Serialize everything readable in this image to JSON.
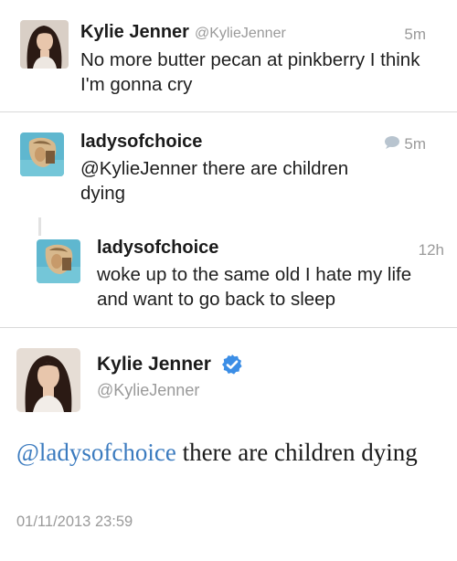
{
  "tweets": [
    {
      "name": "Kylie Jenner",
      "handle": "@KylieJenner",
      "time": "5m",
      "text": "No more butter pecan at pinkberry I think I'm gonna cry"
    },
    {
      "name": "ladysofchoice",
      "time": "5m",
      "text": "@KylieJenner there are children dying"
    },
    {
      "name": "ladysofchoice",
      "time": "12h",
      "text": "woke up to the same old I hate my life and want to go back to sleep"
    }
  ],
  "featured": {
    "name": "Kylie Jenner",
    "handle": "@KylieJenner",
    "mention": "@ladysofchoice",
    "text": " there are children dying",
    "timestamp": "01/11/2013 23:59"
  },
  "icons": {
    "reply": "speech-bubble-icon",
    "verified": "verified-badge-icon"
  },
  "colors": {
    "link": "#3b7bbf",
    "verified": "#3c8ee6",
    "muted": "#9a9a9a"
  }
}
